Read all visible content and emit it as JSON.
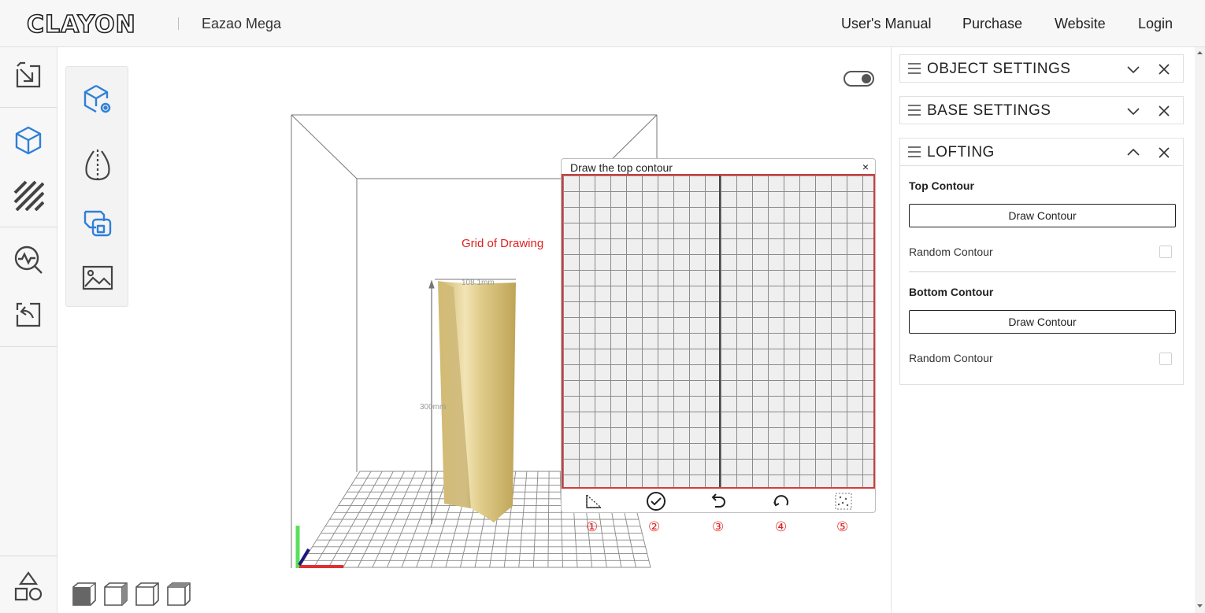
{
  "header": {
    "brand": "CLAYON",
    "product": "Eazao Mega",
    "links": [
      "User's Manual",
      "Purchase",
      "Website",
      "Login"
    ]
  },
  "left_toolbar": {
    "icons": [
      "import-icon",
      "model-cube-icon",
      "texture-stripes-icon",
      "analyze-icon",
      "export-icon",
      "shapes-library-icon"
    ]
  },
  "sub_toolbar": {
    "icons": [
      "cube-settings-icon",
      "vase-profile-icon",
      "lofting-icon",
      "image-icon"
    ]
  },
  "viewport": {
    "annotation": "Grid of Drawing",
    "dims": {
      "width": "108.1mm",
      "height": "300mm"
    },
    "view_buttons": [
      "front-view-icon",
      "side-view-icon",
      "iso-view-icon",
      "top-view-icon"
    ]
  },
  "draw_dialog": {
    "title": "Draw the top contour",
    "close": "×",
    "tools": [
      {
        "icon": "draw-polyline-icon",
        "num": "①"
      },
      {
        "icon": "confirm-check-icon",
        "num": "②"
      },
      {
        "icon": "undo-icon",
        "num": "③"
      },
      {
        "icon": "reset-icon",
        "num": "④"
      },
      {
        "icon": "random-points-icon",
        "num": "⑤"
      }
    ]
  },
  "right_panel": {
    "object_settings": {
      "title": "OBJECT SETTINGS"
    },
    "base_settings": {
      "title": "BASE SETTINGS"
    },
    "lofting": {
      "title": "LOFTING",
      "top": {
        "heading": "Top Contour",
        "button": "Draw Contour",
        "random_label": "Random Contour",
        "random_checked": false
      },
      "bottom": {
        "heading": "Bottom Contour",
        "button": "Draw Contour",
        "random_label": "Random Contour",
        "random_checked": false
      }
    }
  },
  "colors": {
    "accent": "#2f7fd8",
    "highlight": "#e02020",
    "model": "#d9c486"
  }
}
